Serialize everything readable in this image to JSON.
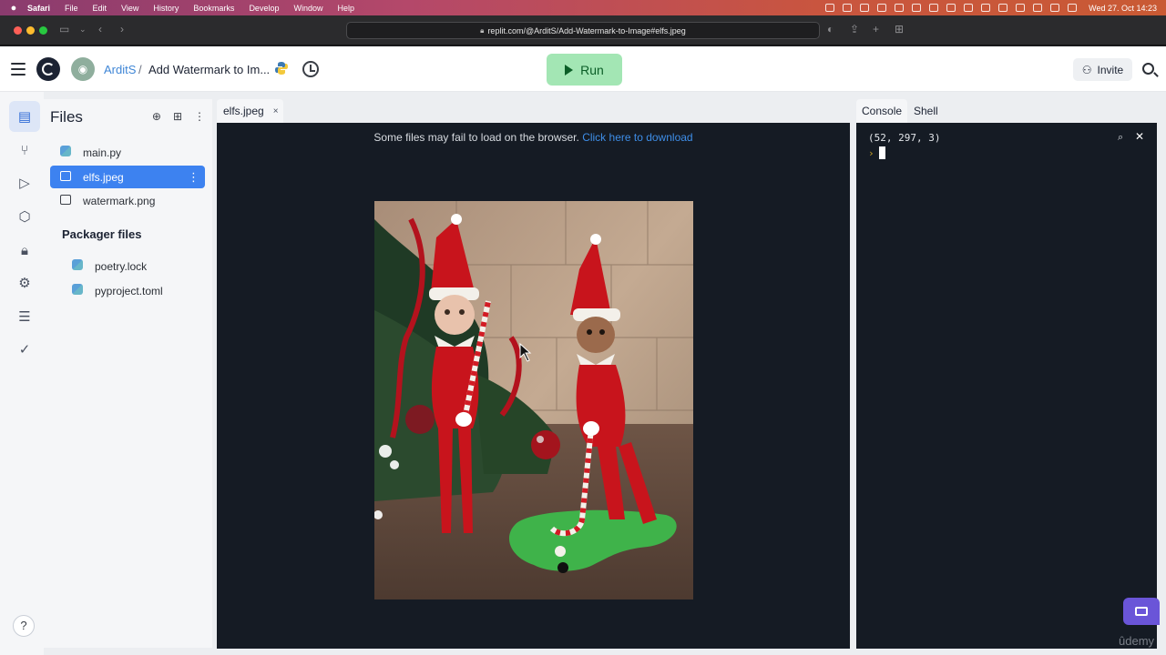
{
  "os_menubar": {
    "apple": "",
    "items": [
      "Safari",
      "File",
      "Edit",
      "View",
      "History",
      "Bookmarks",
      "Develop",
      "Window",
      "Help"
    ],
    "clock": "Wed 27. Oct 14:23"
  },
  "browser": {
    "url": "replit.com/@ArditS/Add-Watermark-to-Image#elfs.jpeg"
  },
  "header": {
    "user": "ArditS",
    "separator": "/",
    "repl_name": "Add Watermark to Im...",
    "run_label": "Run",
    "invite_label": "Invite"
  },
  "files_panel": {
    "title": "Files",
    "files": [
      {
        "name": "main.py",
        "icon": "python-icon",
        "selected": false
      },
      {
        "name": "elfs.jpeg",
        "icon": "image-icon",
        "selected": true
      },
      {
        "name": "watermark.png",
        "icon": "image-icon",
        "selected": false
      }
    ],
    "packager_title": "Packager files",
    "packager_files": [
      {
        "name": "poetry.lock",
        "icon": "python-icon"
      },
      {
        "name": "pyproject.toml",
        "icon": "python-icon"
      }
    ]
  },
  "editor": {
    "tab_label": "elfs.jpeg",
    "tab_close": "×",
    "notice_text": "Some files may fail to load on the browser. ",
    "notice_link": "Click here to download"
  },
  "console": {
    "tabs": [
      "Console",
      "Shell"
    ],
    "output": "(52, 297, 3)",
    "prompt": "›"
  },
  "watermark": "ûdemy",
  "help": "?",
  "colors": {
    "run_bg": "#a3e6b4",
    "selected_file": "#3d82f0",
    "editor_bg": "#151b24",
    "link": "#3e8ee8"
  }
}
